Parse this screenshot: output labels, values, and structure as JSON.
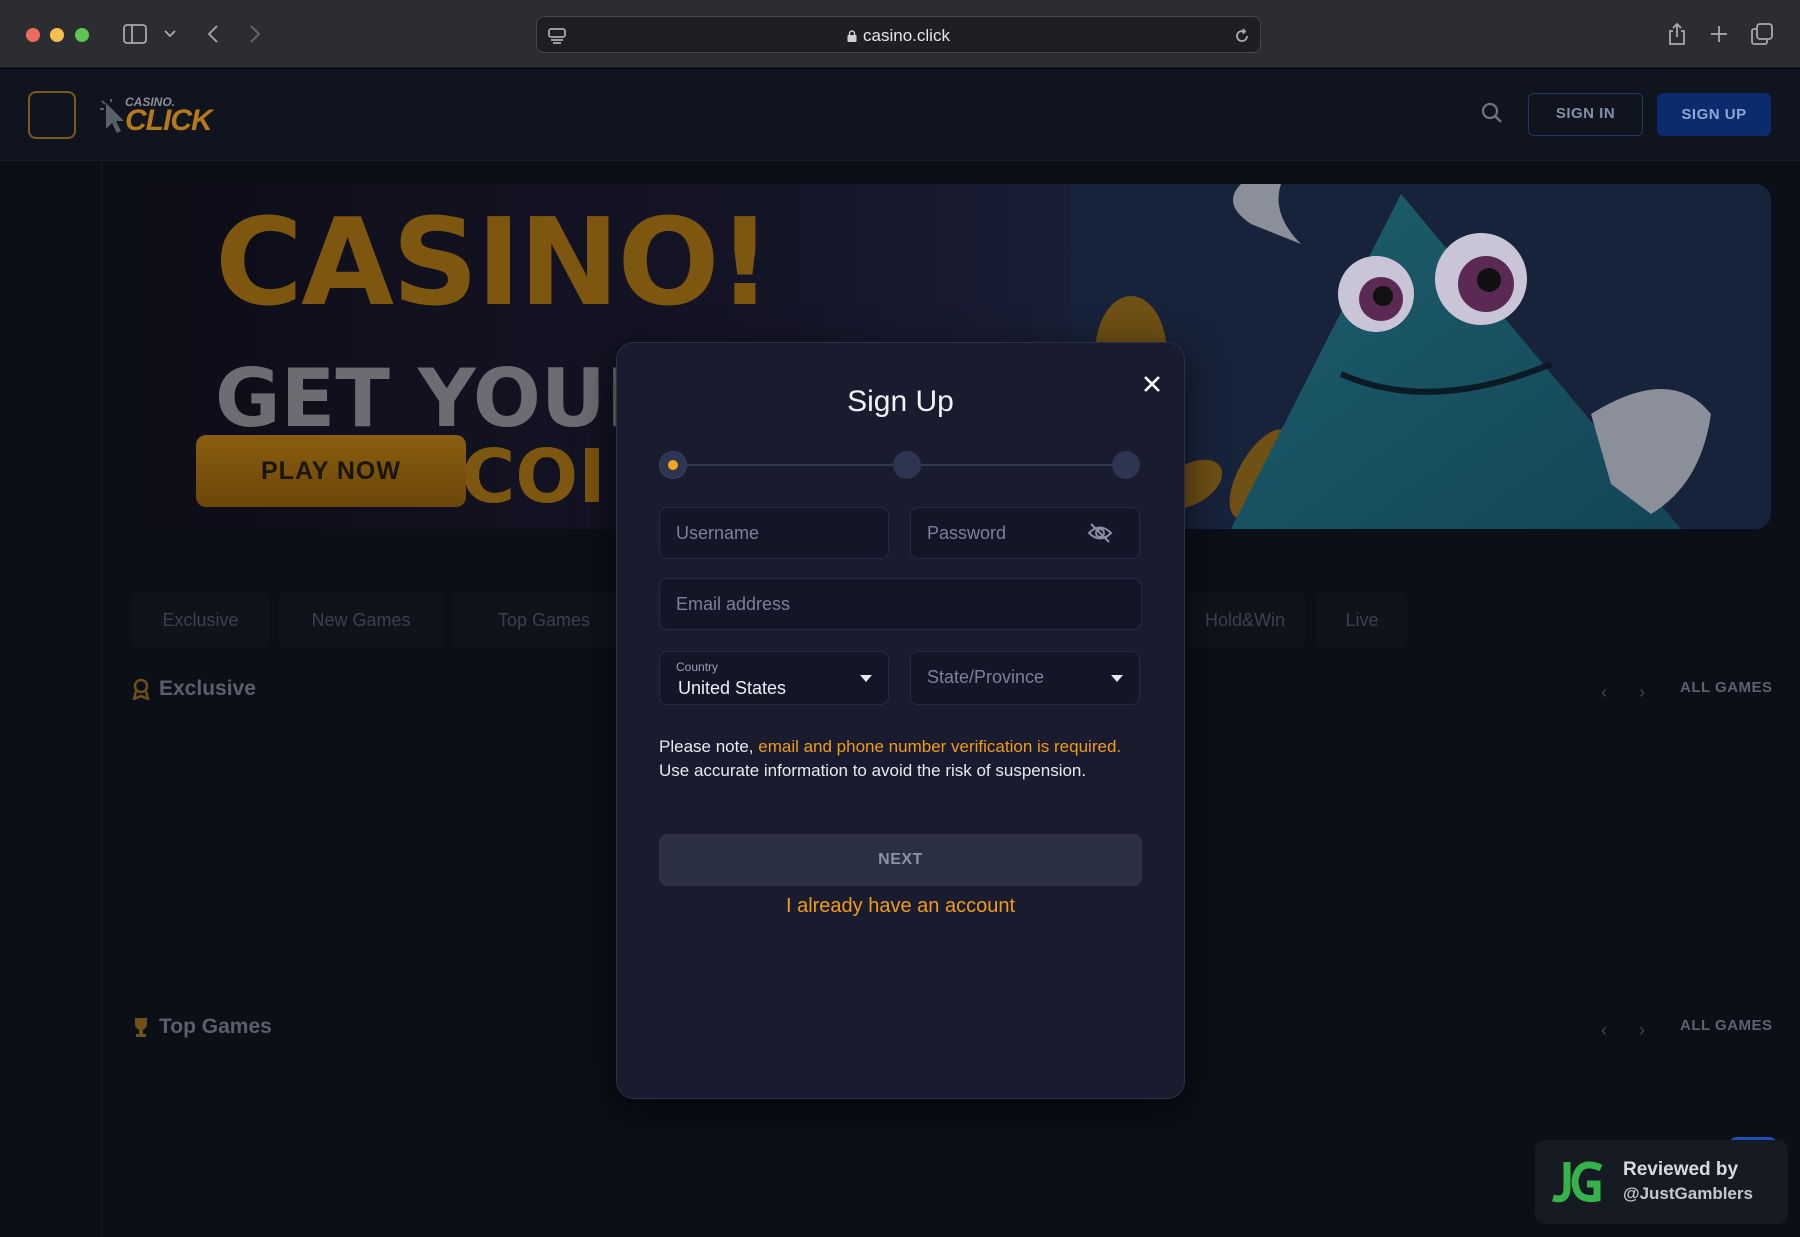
{
  "browser": {
    "url": "casino.click"
  },
  "header": {
    "logo_small": "CASINO.",
    "logo_big": "CLICK",
    "signin_label": "SIGN IN",
    "signup_label": "SIGN UP"
  },
  "banner": {
    "headline": "CASINO!",
    "line2": "GET YOUR",
    "line3": "COI",
    "cta": "PLAY NOW"
  },
  "categories": [
    "Exclusive",
    "New Games",
    "Top Games",
    "Hold&Win",
    "Live"
  ],
  "sections": {
    "exclusive": {
      "title": "Exclusive",
      "all_games": "ALL GAMES"
    },
    "top_games": {
      "title": "Top Games",
      "all_games": "ALL GAMES"
    }
  },
  "modal": {
    "title": "Sign Up",
    "steps": {
      "total": 3,
      "current": 1
    },
    "username_placeholder": "Username",
    "password_placeholder": "Password",
    "email_placeholder": "Email address",
    "country_label": "Country",
    "country_value": "United States",
    "state_placeholder": "State/Province",
    "note_prefix": "Please note, ",
    "note_highlight": "email and phone number verification is required.",
    "note_suffix": " Use accurate information to avoid the risk of suspension.",
    "next_label": "NEXT",
    "account_link": "I already have an account"
  },
  "badge": {
    "line1": "Reviewed by",
    "line2": "@JustGamblers"
  },
  "colors": {
    "accent": "#f29b1a",
    "modal_bg": "#181c2e",
    "page_bg": "#0b0f17"
  }
}
